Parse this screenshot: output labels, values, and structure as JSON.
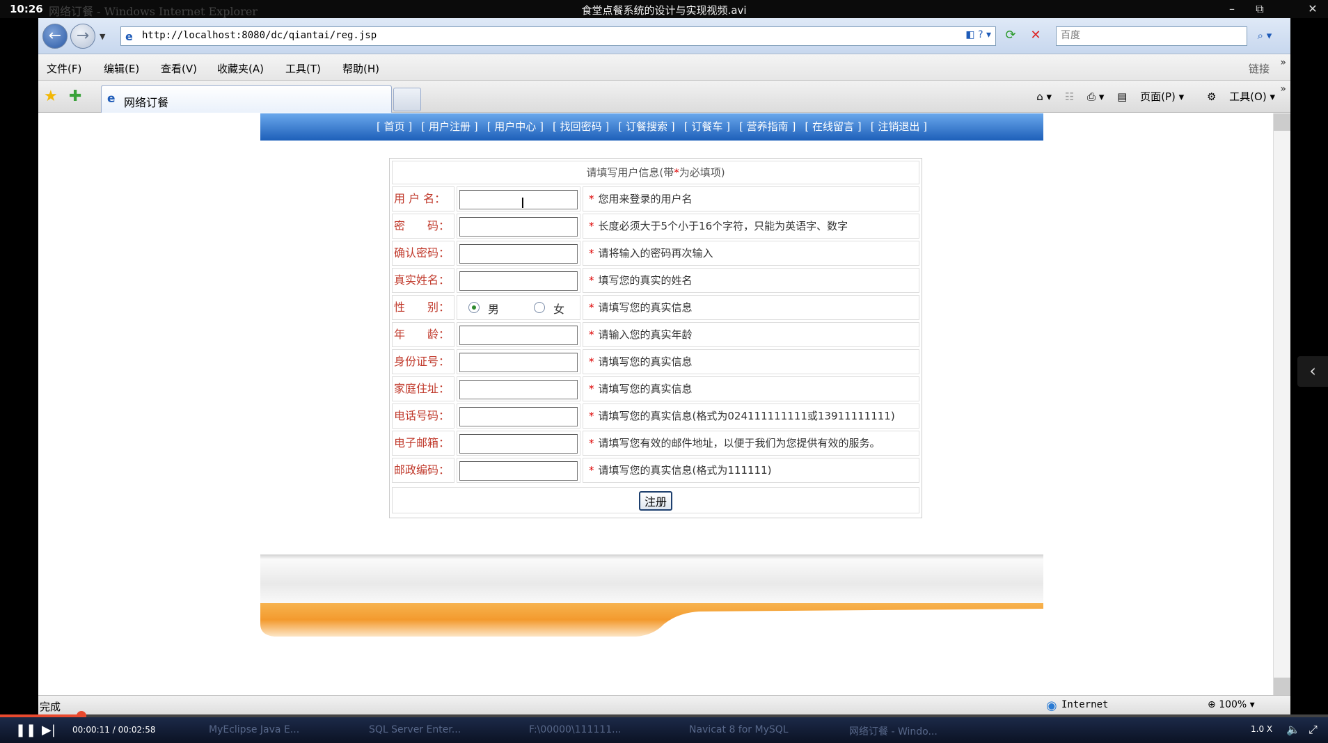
{
  "player": {
    "clock": "10:26",
    "window_ghost": "网络订餐 - Windows Internet Explorer",
    "file_title": "食堂点餐系统的设计与实现视频.avi",
    "current_time": "00:00:11 / 00:02:58",
    "progress_fraction": 0.065,
    "speed": "1.0 X",
    "taskbar": [
      "MyEclipse Java E...",
      "SQL Server Enter...",
      "F:\\00000\\111111...",
      "Navicat 8 for MySQL",
      "网络订餐 - Windo..."
    ]
  },
  "browser": {
    "url": "http://localhost:8080/dc/qiantai/reg.jsp",
    "search_placeholder": "百度",
    "menu": [
      "文件(F)",
      "编辑(E)",
      "查看(V)",
      "收藏夹(A)",
      "工具(T)",
      "帮助(H)"
    ],
    "links_label": "链接",
    "tab_title": "网络订餐",
    "cmd": {
      "page": "页面(P)",
      "tools": "工具(O)"
    },
    "status": "完成",
    "zone": "Internet",
    "zoom": "100%"
  },
  "site_nav": [
    "[ 首页 ]",
    "[ 用户注册 ]",
    "[ 用户中心 ]",
    "[ 找回密码 ]",
    "[ 订餐搜索 ]",
    "[ 订餐车 ]",
    "[ 营养指南 ]",
    "[ 在线留言 ]",
    "[ 注销退出 ]"
  ],
  "form": {
    "caption_pre": "请填写用户信息(带",
    "caption_star": "*",
    "caption_post": "为必填项)",
    "required_mark": "*",
    "rows": [
      {
        "label": "用 户 名：",
        "hint": "您用来登录的用户名",
        "value": ""
      },
      {
        "label": "密　　码：",
        "hint": "长度必须大于5个小于16个字符，只能为英语字、数字",
        "value": ""
      },
      {
        "label": "确认密码：",
        "hint": "请将输入的密码再次输入",
        "value": ""
      },
      {
        "label": "真实姓名：",
        "hint": "填写您的真实的姓名",
        "value": ""
      },
      {
        "label": "性　　别：",
        "hint": "请填写您的真实信息"
      },
      {
        "label": "年　　龄：",
        "hint": "请输入您的真实年龄",
        "value": ""
      },
      {
        "label": "身份证号：",
        "hint": "请填写您的真实信息",
        "value": ""
      },
      {
        "label": "家庭住址：",
        "hint": "请填写您的真实信息",
        "value": ""
      },
      {
        "label": "电话号码：",
        "hint": "请填写您的真实信息(格式为024111111111或13911111111)",
        "value": ""
      },
      {
        "label": "电子邮箱：",
        "hint": "请填写您有效的邮件地址，以便于我们为您提供有效的服务。",
        "value": ""
      },
      {
        "label": "邮政编码：",
        "hint": "请填写您的真实信息(格式为111111)",
        "value": ""
      }
    ],
    "gender": {
      "male": "男",
      "female": "女",
      "selected": "male"
    },
    "submit_label": "注册"
  },
  "colors": {
    "nav_top": "#6aa8ec",
    "nav_bottom": "#1d5fb9",
    "label": "#c0392b",
    "required": "#dd0000",
    "footer_orange": "#f39a2e"
  }
}
